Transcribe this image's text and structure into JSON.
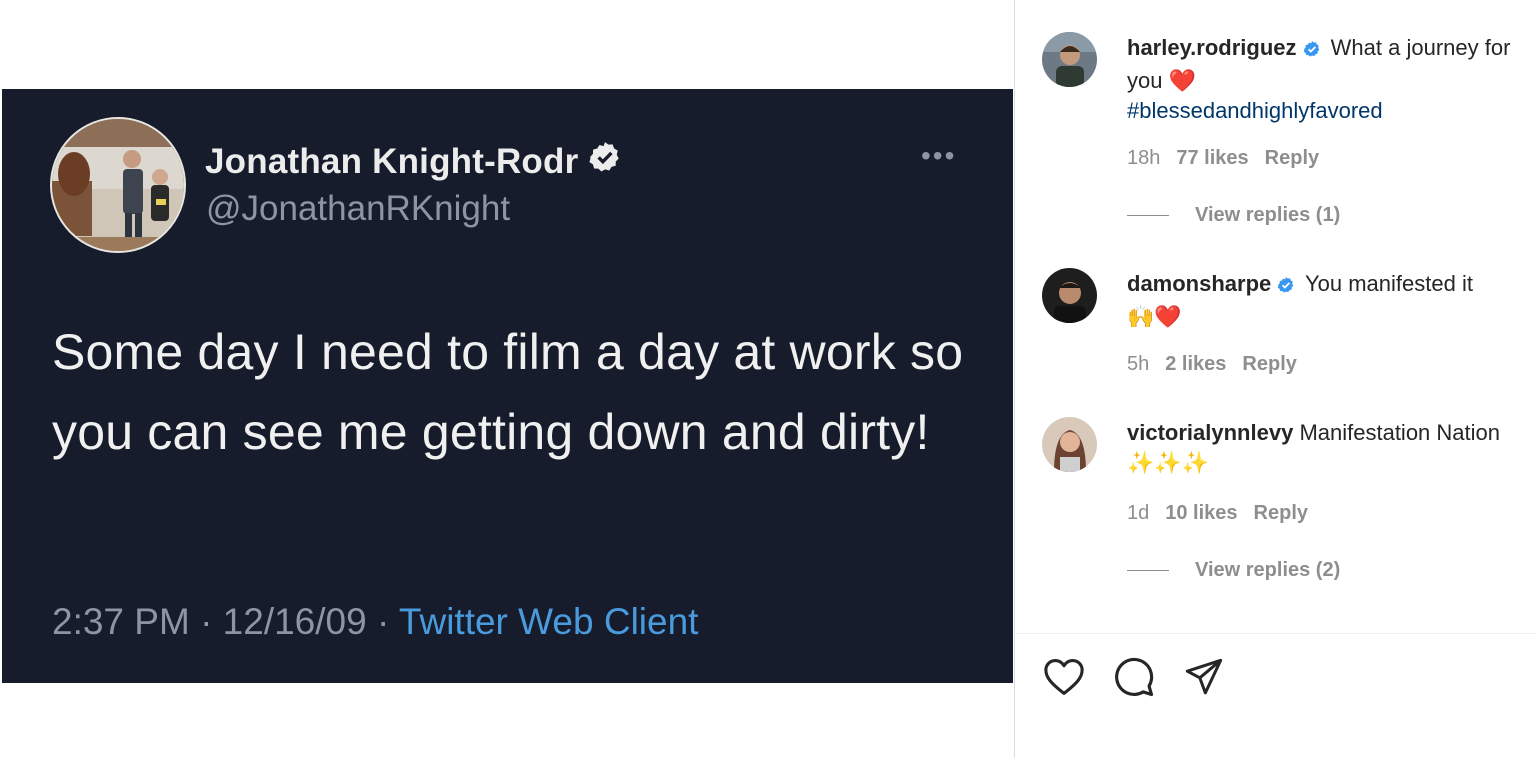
{
  "tweet": {
    "name": "Jonathan Knight-Rodr",
    "handle": "@JonathanRKnight",
    "more_icon": "more-horizontal-icon",
    "body": "Some day I need to film a day at work so you can see me getting down and dirty!",
    "time": "2:37 PM · 12/16/09 · ",
    "client": "Twitter Web Client"
  },
  "comments": [
    {
      "username": "harley.rodriguez",
      "verified": true,
      "text": "What a journey for you",
      "emoji": "❤️",
      "hashtag": "#blessedandhighlyfavored",
      "age": "18h",
      "likes": "77 likes",
      "reply": "Reply",
      "view_replies": "View replies (1)"
    },
    {
      "username": "damonsharpe",
      "verified": true,
      "text": "You manifested it",
      "emoji": "🙌❤️",
      "age": "5h",
      "likes": "2 likes",
      "reply": "Reply"
    },
    {
      "username": "victorialynnlevy",
      "verified": false,
      "text": "Manifestation Nation",
      "emoji": "✨✨✨",
      "age": "1d",
      "likes": "10 likes",
      "reply": "Reply",
      "view_replies": "View replies (2)"
    }
  ],
  "actions": [
    "heart-icon",
    "comment-icon",
    "share-icon"
  ],
  "colors": {
    "tweet_bg": "#161c2b",
    "link_blue": "#4a9bdd",
    "hashtag": "#00376b",
    "verified": "#3897f0",
    "muted": "#8e8e8e"
  }
}
